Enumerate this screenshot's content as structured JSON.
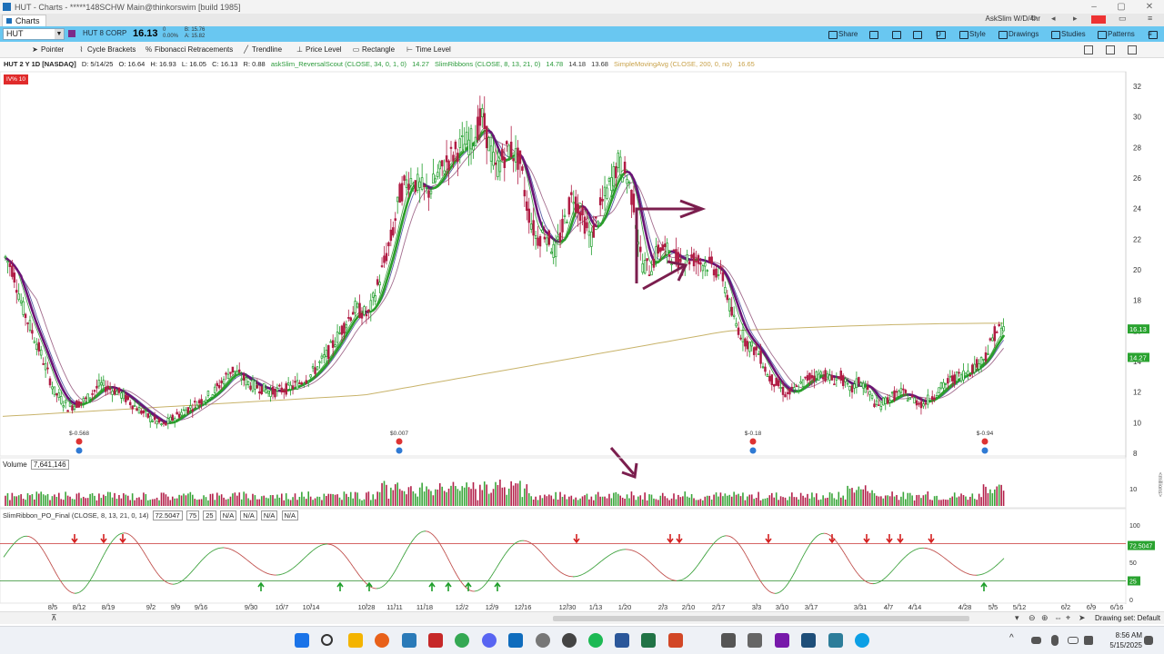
{
  "window": {
    "title": "HUT - Charts - *****148SCHW Main@thinkorswim [build 1985]",
    "tab_label": "Charts",
    "account_label": "AskSlim W/D/4hr"
  },
  "symbol_bar": {
    "symbol": "HUT",
    "company": "HUT 8 CORP",
    "last_price": "16.13",
    "change": "0",
    "change_pct": "0.00%",
    "bid": "B: 15.76",
    "ask": "A: 15.82",
    "buttons": {
      "share": "Share",
      "style": "Style",
      "drawings": "Drawings",
      "studies": "Studies",
      "patterns": "Patterns",
      "period": "D"
    }
  },
  "drawing_tools": [
    "Pointer",
    "Cycle Brackets",
    "Fibonacci Retracements",
    "Trendline",
    "Price Level",
    "Rectangle",
    "Time Level"
  ],
  "study_header": {
    "symbol_info": "HUT 2 Y 1D [NASDAQ]",
    "date": "D: 5/14/25",
    "open": "O: 16.64",
    "high": "H: 16.93",
    "low": "L: 16.05",
    "close": "C: 16.13",
    "range": "R: 0.88",
    "reversal_scout": "askSlim_ReversalScout (CLOSE, 34, 0, 1, 0)",
    "reversal_scout_val": "14.27",
    "ribbons": "SlimRibbons (CLOSE, 8, 13, 21, 0)",
    "ribbon_vals": [
      "14.78",
      "14.18",
      "13.68"
    ],
    "sma": "SimpleMovingAvg (CLOSE, 200, 0, no)",
    "sma_val": "16.65"
  },
  "iv_badge": "IV% 10",
  "volume_header": {
    "label": "Volume",
    "value": "7,641,146"
  },
  "oscillator_header": {
    "label": "SlimRibbon_PO_Final (CLOSE, 8, 13, 21, 0, 14)",
    "value": "72.5047",
    "vals": [
      "75",
      "25",
      "N/A",
      "N/A",
      "N/A",
      "N/A"
    ]
  },
  "dividends": [
    {
      "label": "$-0.568"
    },
    {
      "label": "$0.007"
    },
    {
      "label": "$-0.18"
    },
    {
      "label": "$-0.94"
    }
  ],
  "price_axis": {
    "ticks": [
      "32",
      "30",
      "28",
      "26",
      "24",
      "22",
      "20",
      "18",
      "16",
      "14",
      "12",
      "10",
      "8"
    ],
    "last_tag": "16.13",
    "scout_tag": "14.27"
  },
  "volume_axis": {
    "tick": "10",
    "unit": "<millions>"
  },
  "osc_axis": {
    "ticks": [
      "100",
      "75",
      "50",
      "25",
      "0"
    ],
    "tag": "72.5047",
    "low_tag": "25"
  },
  "time_axis": [
    "8/5",
    "8/12",
    "8/19",
    "9/2",
    "9/9",
    "9/16",
    "9/30",
    "10/7",
    "10/14",
    "10/28",
    "11/11",
    "11/18",
    "12/2",
    "12/9",
    "12/16",
    "12/30",
    "1/13",
    "1/20",
    "2/3",
    "2/10",
    "2/17",
    "3/3",
    "3/10",
    "3/17",
    "3/31",
    "4/7",
    "4/14",
    "4/28",
    "5/5",
    "5/12",
    "6/2",
    "6/9",
    "6/16"
  ],
  "scroll_row": {
    "drawing_set": "Drawing set: Default"
  },
  "taskbar": {
    "time": "8:56 AM",
    "date": "5/15/2025"
  },
  "colors": {
    "toolbar": "#69c7f1",
    "up": "#1e9e2a",
    "down": "#b01c44",
    "ribbon_fast": "#2ba02b",
    "scout": "#6b1476",
    "sma": "#c8b36a",
    "annot": "#7b1e4e"
  }
}
